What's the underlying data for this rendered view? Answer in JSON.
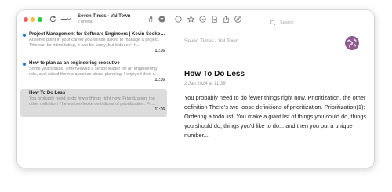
{
  "toolbar": {
    "feed_title": "Seven Times - Val Town",
    "feed_subtitle": "2 unread",
    "search_placeholder": "Search",
    "icons": [
      "refresh-icon",
      "plus-icon",
      "chevron-down-icon",
      "pointer-icon",
      "circle-icon",
      "star-icon",
      "ellipsis-icon",
      "document-icon",
      "share-icon",
      "compass-icon",
      "search-icon"
    ]
  },
  "list": {
    "items": [
      {
        "title": "Project Management for Software Engineers | Kevin Sookocheff",
        "excerpt": "At some point in your career you will be asked to manage a project. This can be intimidating, it can be scary, but it doesn't h...",
        "time": "11:36",
        "unread": true
      },
      {
        "title": "How to plan as an engineering executive",
        "excerpt": "Some years back, I interviewed a senior leader for an engineering role, and asked them a question about planning. I enjoyed their r...",
        "time": "11:36",
        "unread": true
      },
      {
        "title": "How To Do Less",
        "excerpt": "You probably need to do fewer things right now. Prioritization, the other definition There's two loose definitions of prioritization. Pri...",
        "time": "11:36",
        "unread": false
      }
    ]
  },
  "reader": {
    "feed_name": "Seven Times - Val Town",
    "title": "How To Do Less",
    "date": "2 Jan 2024 at 11:36",
    "body": "You probably need to do fewer things right now. Prioritization, the other definition There's two loose definitions of prioritization. Prioritization(1): Ordering a todo list. You make a giant list of things you could do, things you should do, things you'd like to do... and then you put a unique number..."
  },
  "colors": {
    "accent": "#1a7ad9",
    "selection": "#dcdcdc",
    "avatar": "#8e5a8f"
  }
}
